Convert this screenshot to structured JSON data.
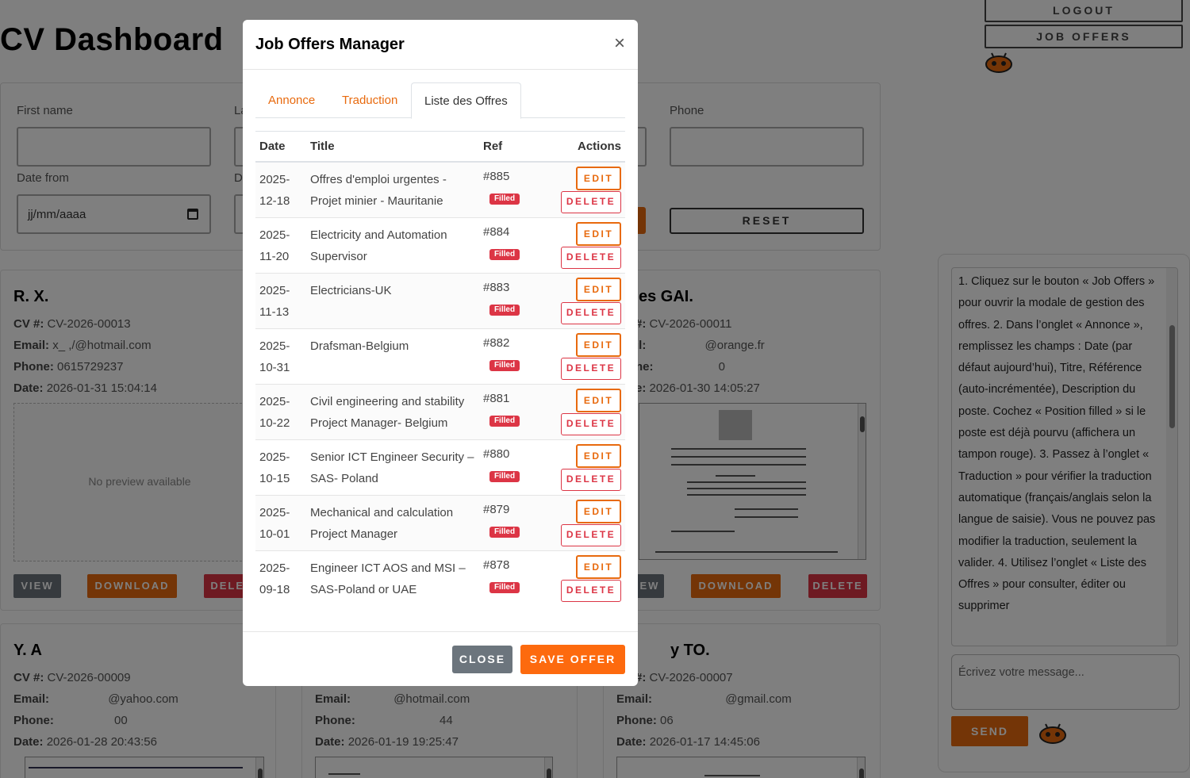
{
  "page": {
    "title": "CV Dashboard",
    "logout_label": "LOGOUT",
    "job_offers_label": "JOB OFFERS"
  },
  "filters": {
    "first_name_label": "First name",
    "last_name_label_partial": "La",
    "phone_label": "Phone",
    "date_from_label": "Date from",
    "date_to_label_partial": "D",
    "date_placeholder": "jj/mm/aaaa",
    "reset_label": "RESET"
  },
  "cards": [
    {
      "name": "R.          X.",
      "cv_label": "CV #:",
      "cv": "CV-2026-00013",
      "email_label": "Email:",
      "email": "x_        ,/@hotmail.com",
      "phone_label": "Phone:",
      "phone": "0615729237",
      "date_label": "Date:",
      "date": "2026-01-31 15:04:14",
      "preview": "No preview available",
      "view": "VIEW",
      "download": "DOWNLOAD",
      "delete": "DELETE"
    },
    {
      "name": "es GAI.",
      "cv_label": "#:",
      "cv": "CV-2026-00011",
      "email_label": "il:",
      "email": "@orange.fr",
      "phone_label": "ne:",
      "phone": "0",
      "date_label": "e:",
      "date": "2026-01-30 14:05:27",
      "view": "EW",
      "download": "DOWNLOAD",
      "delete": "DELETE"
    },
    {
      "name": "Y.     A",
      "cv_label": "CV #:",
      "cv": "CV-2026-00009",
      "email_label": "Email:",
      "email": "@yahoo.com",
      "phone_label": "Phone:",
      "phone": "00",
      "date_label": "Date:",
      "date": "2026-01-28 20:43:56"
    },
    {
      "email_label": "Email:",
      "email": "@hotmail.com",
      "phone_label": "Phone:",
      "phone": "44",
      "date_label": "Date:",
      "date": "2026-01-19 19:25:47"
    },
    {
      "name": "y TO.",
      "cv_label": "#:",
      "cv": "CV-2026-00007",
      "email_label": "Email:",
      "email": "@gmail.com",
      "phone_label": "Phone:",
      "phone": "06",
      "date_label": "Date:",
      "date": "2026-01-17 14:45:06"
    }
  ],
  "chat": {
    "message": "1. Cliquez sur le bouton « Job Offers » pour ouvrir la modale de gestion des offres. 2. Dans l’onglet « Annonce », remplissez les champs : Date (par défaut aujourd’hui), Titre, Référence (auto-incrémentée), Description du poste. Cochez « Position filled » si le poste est déjà pourvu (affichera un tampon rouge). 3. Passez à l’onglet « Traduction » pour vérifier la traduction automatique (français/anglais selon la langue de saisie). Vous ne pouvez pas modifier la traduction, seulement la valider. 4. Utilisez l’onglet « Liste des Offres » pour consulter, éditer ou supprimer",
    "input_placeholder": "Écrivez votre message...",
    "send_label": "SEND"
  },
  "modal": {
    "title": "Job Offers Manager",
    "close_symbol": "×",
    "tabs": [
      "Annonce",
      "Traduction",
      "Liste des Offres"
    ],
    "active_tab": "Liste des Offres",
    "columns": [
      "Date",
      "Title",
      "Ref",
      "Actions"
    ],
    "rows": [
      {
        "date": "2025-12-18",
        "title": "Offres d'emploi urgentes - Projet minier - Mauritanie",
        "ref": "#885",
        "status": "Filled"
      },
      {
        "date": "2025-11-20",
        "title": "Electricity and Automation Supervisor",
        "ref": "#884",
        "status": "Filled"
      },
      {
        "date": "2025-11-13",
        "title": "Electricians-UK",
        "ref": "#883",
        "status": "Filled"
      },
      {
        "date": "2025-10-31",
        "title": "Drafsman-Belgium",
        "ref": "#882",
        "status": "Filled"
      },
      {
        "date": "2025-10-22",
        "title": "Civil engineering and stability Project Manager- Belgium",
        "ref": "#881",
        "status": "Filled"
      },
      {
        "date": "2025-10-15",
        "title": "Senior ICT Engineer Security – SAS- Poland",
        "ref": "#880",
        "status": "Filled"
      },
      {
        "date": "2025-10-01",
        "title": "Mechanical and calculation Project Manager",
        "ref": "#879",
        "status": "Filled"
      },
      {
        "date": "2025-09-18",
        "title": "Engineer ICT AOS and MSI – SAS-Poland or UAE",
        "ref": "#878",
        "status": "Filled"
      }
    ],
    "edit_label": "EDIT",
    "delete_label": "DELETE",
    "close_label": "CLOSE",
    "save_label": "SAVE OFFER"
  },
  "colors": {
    "accent": "#e86a0e",
    "danger": "#dc3545",
    "secondary": "#6c757d"
  }
}
